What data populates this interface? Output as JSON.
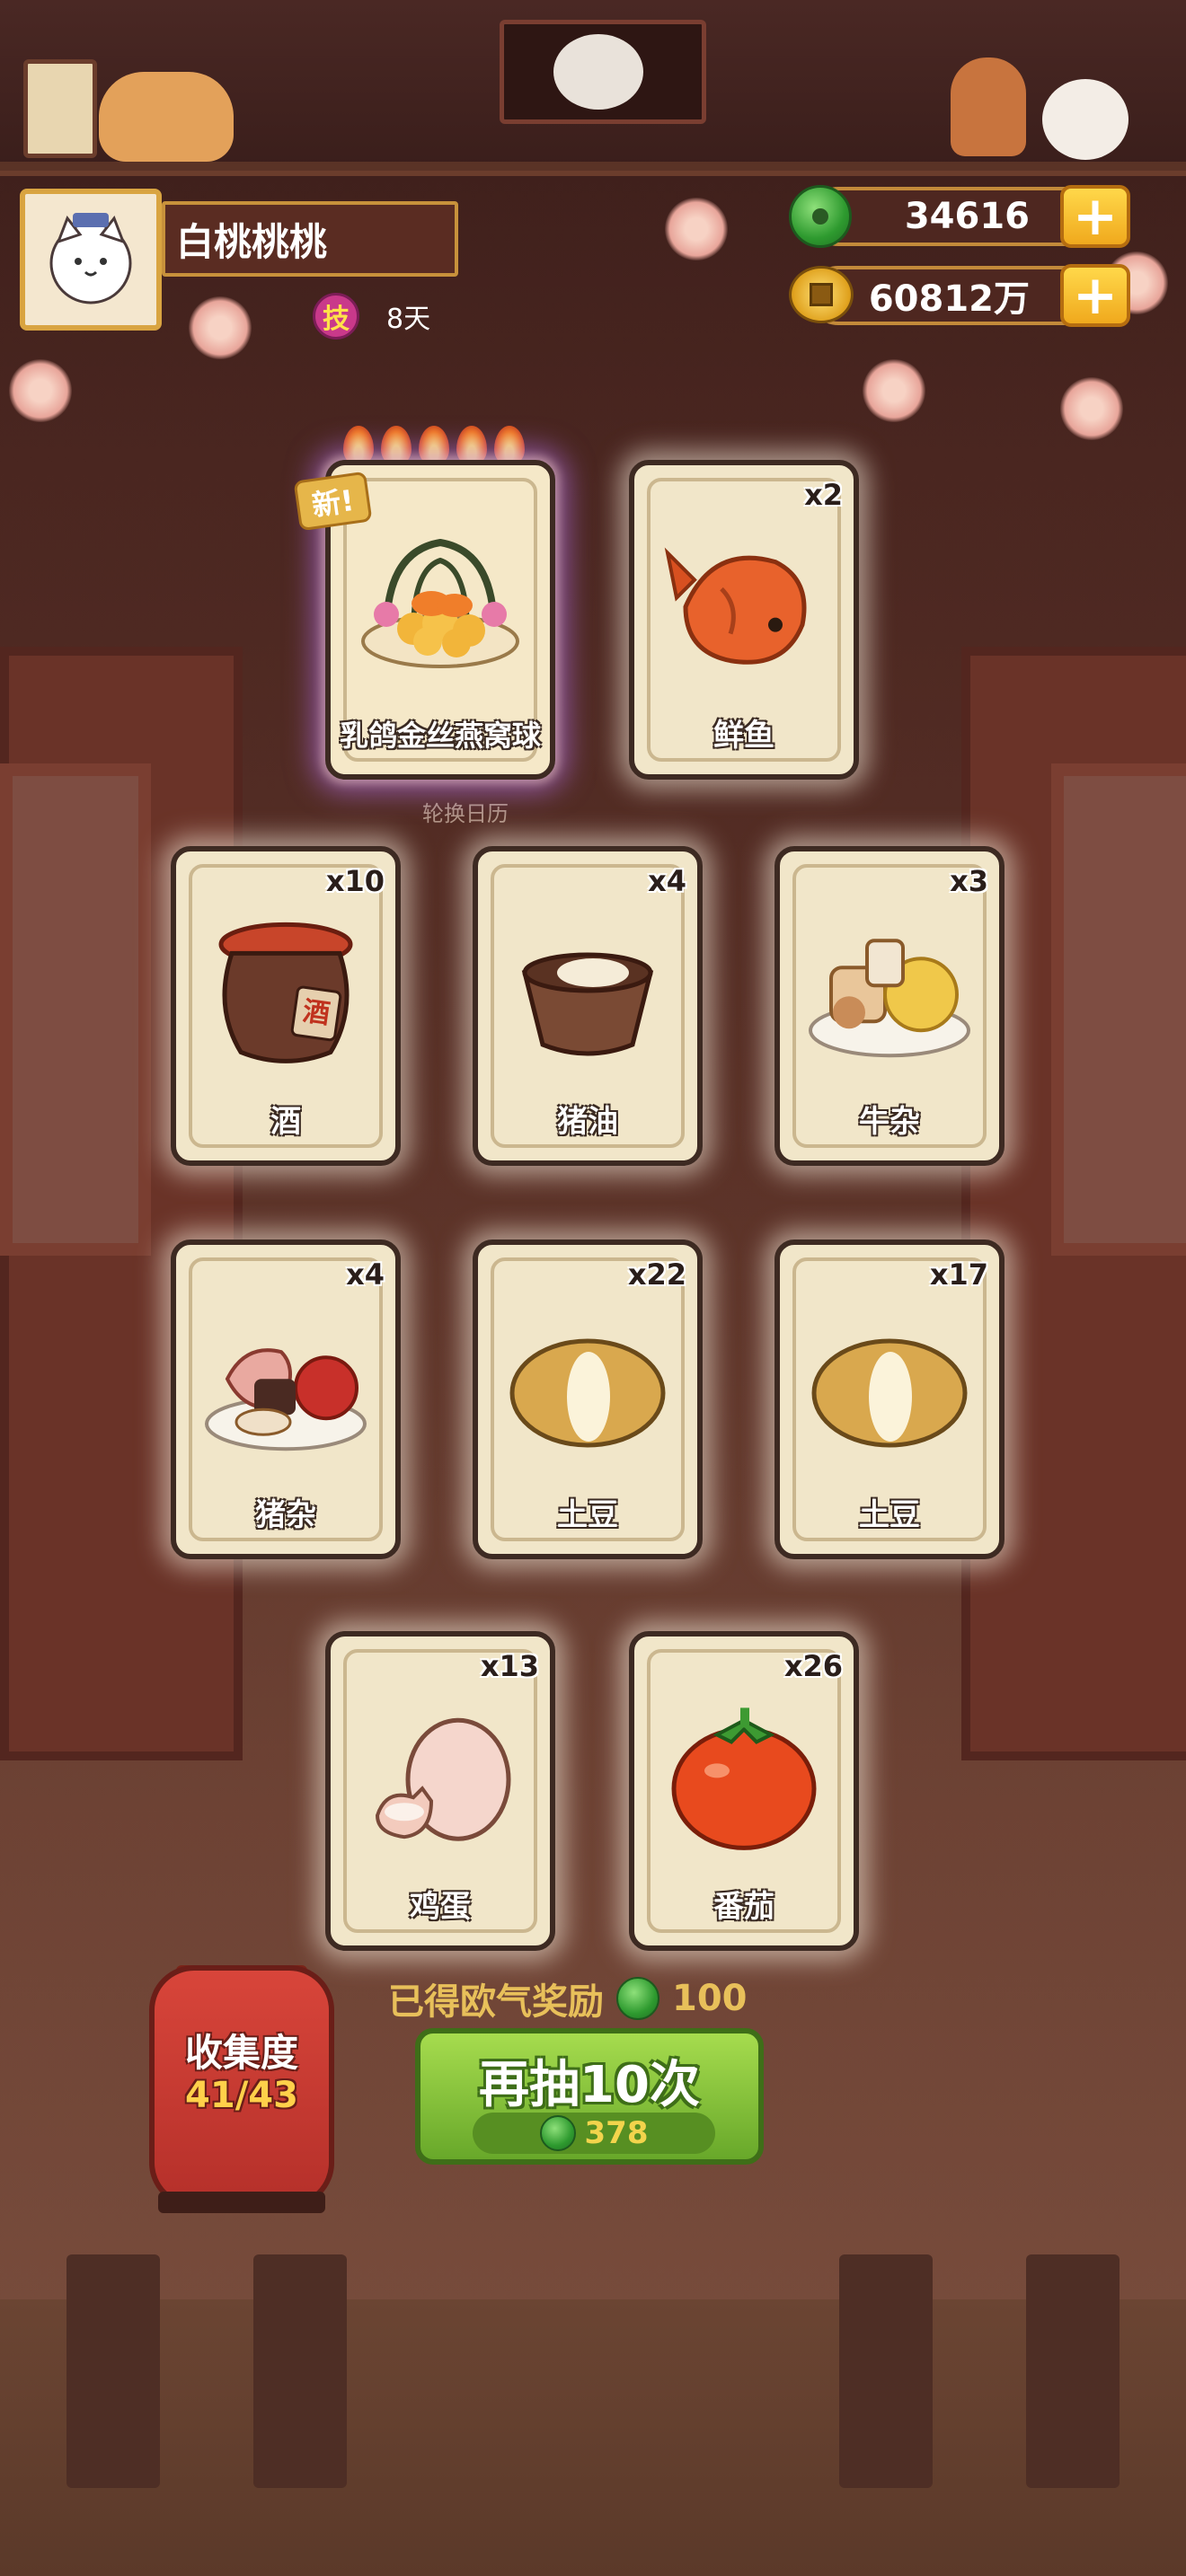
{
  "profile": {
    "name": "白桃桃桃",
    "skill_badge": "技",
    "days": "8天"
  },
  "currency": {
    "jade_amount": "34616",
    "coin_amount": "60812万",
    "plus_label": "+"
  },
  "featured_card": {
    "name": "乳鸽金丝燕窝球",
    "new_tag": "新!",
    "flames": 5
  },
  "background_text": "轮换日历",
  "cards": [
    {
      "name": "鲜鱼",
      "count": "x2",
      "icon": "fish-icon"
    },
    {
      "name": "酒",
      "count": "x10",
      "icon": "wine-jar-icon",
      "jar_label": "酒"
    },
    {
      "name": "猪油",
      "count": "x4",
      "icon": "lard-bowl-icon"
    },
    {
      "name": "牛杂",
      "count": "x3",
      "icon": "beef-offal-plate-icon"
    },
    {
      "name": "猪杂",
      "count": "x4",
      "icon": "pork-offal-plate-icon"
    },
    {
      "name": "土豆",
      "count": "x22",
      "icon": "potato-icon"
    },
    {
      "name": "土豆",
      "count": "x17",
      "icon": "potato-icon"
    },
    {
      "name": "鸡蛋",
      "count": "x13",
      "icon": "egg-icon"
    },
    {
      "name": "番茄",
      "count": "x26",
      "icon": "tomato-icon"
    }
  ],
  "reward": {
    "label": "已得欧气奖励",
    "amount": "100"
  },
  "draw_button": {
    "label": "再抽10次",
    "cost": "378"
  },
  "collection": {
    "label": "收集度",
    "value": "41/43"
  },
  "colors": {
    "accent_gold": "#d9a441",
    "button_green": "#68a82a",
    "lantern_red": "#c8392f"
  }
}
